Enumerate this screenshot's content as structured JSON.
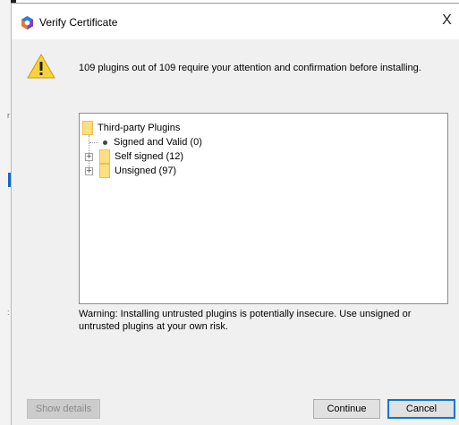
{
  "background": {
    "marks": [
      "r",
      ":"
    ]
  },
  "window": {
    "title": "Verify Certificate",
    "close_glyph": "X",
    "app_icon": "verifier-app-icon"
  },
  "message": {
    "icon": "warning-icon",
    "text": "109 plugins out of 109 require your attention and confirmation before installing."
  },
  "tree": {
    "root": {
      "label": "Third-party Plugins",
      "icon": "folder-icon"
    },
    "children": [
      {
        "label": "Signed and Valid (0)",
        "icon": "leaf-dot-icon",
        "expander": ""
      },
      {
        "label": "Self signed (12)",
        "icon": "folder-icon",
        "expander": "+"
      },
      {
        "label": "Unsigned (97)",
        "icon": "folder-icon",
        "expander": "+"
      }
    ]
  },
  "warning_text": "Warning: Installing untrusted plugins is potentially insecure. Use unsigned or untrusted plugins at your own risk.",
  "buttons": {
    "show_details": "Show details",
    "continue": "Continue",
    "cancel": "Cancel"
  },
  "colors": {
    "dialog_bg": "#f0f0f0",
    "folder": "#ffdf80",
    "default_button_border": "#0078d7"
  }
}
